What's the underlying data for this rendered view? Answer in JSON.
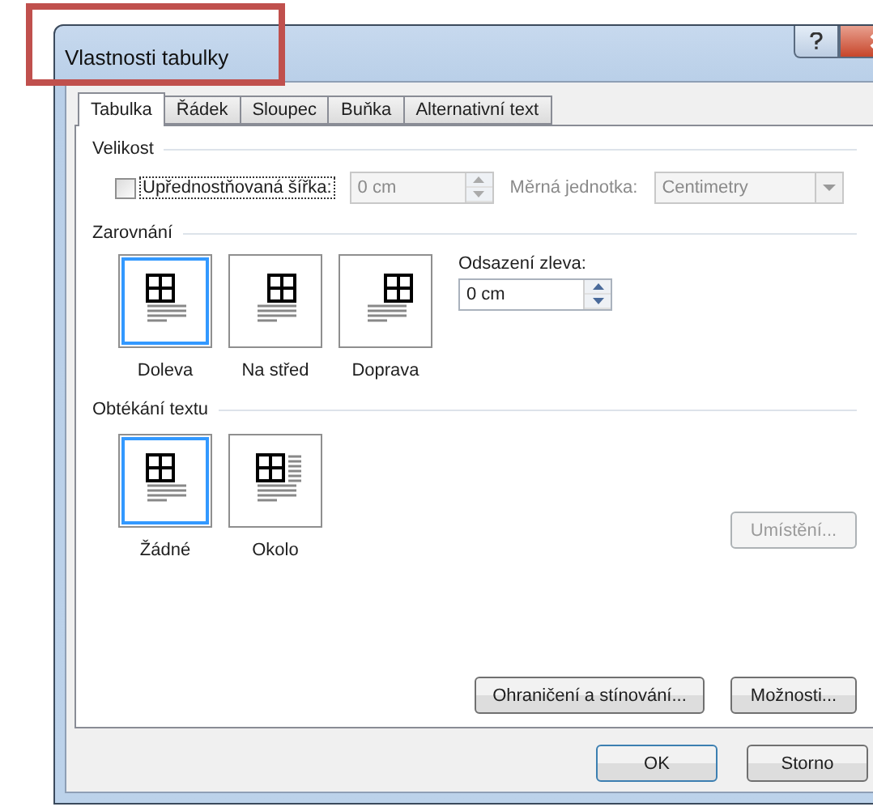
{
  "window": {
    "title": "Vlastnosti tabulky"
  },
  "tabs": [
    {
      "label": "Tabulka",
      "selected": true
    },
    {
      "label": "Řádek",
      "selected": false
    },
    {
      "label": "Sloupec",
      "selected": false
    },
    {
      "label": "Buňka",
      "selected": false
    },
    {
      "label": "Alternativní text",
      "selected": false
    }
  ],
  "size": {
    "heading": "Velikost",
    "preferred_width": {
      "label": "Upřednostňovaná šířka:",
      "checked": false,
      "focused": true
    },
    "width_field": {
      "value": "0 cm",
      "disabled": true
    },
    "unit_label": {
      "label": "Měrná jednotka:",
      "disabled": true
    },
    "unit_select": {
      "value": "Centimetry",
      "disabled": true
    }
  },
  "alignment": {
    "heading": "Zarovnání",
    "options": [
      {
        "kind": "left",
        "label": "Doleva",
        "selected": true
      },
      {
        "kind": "center",
        "label": "Na střed",
        "selected": false
      },
      {
        "kind": "right",
        "label": "Doprava",
        "selected": false
      }
    ],
    "indent": {
      "label": "Odsazení zleva:",
      "value": "0 cm"
    }
  },
  "wrapping": {
    "heading": "Obtékání textu",
    "options": [
      {
        "kind": "none",
        "label": "Žádné",
        "selected": true
      },
      {
        "kind": "around",
        "label": "Okolo",
        "selected": false
      }
    ],
    "position_button": {
      "label": "Umístění...",
      "disabled": true
    }
  },
  "panel_buttons": [
    {
      "label": "Ohraničení a stínování...",
      "disabled": false
    },
    {
      "label": "Možnosti...",
      "disabled": false
    }
  ],
  "buttons": [
    {
      "label": "OK",
      "default": true
    },
    {
      "label": "Storno",
      "default": false
    }
  ]
}
